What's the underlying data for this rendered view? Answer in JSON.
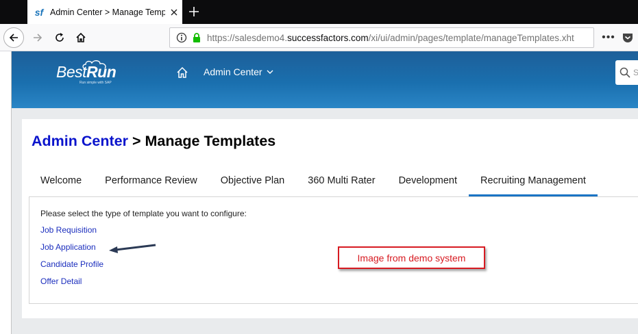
{
  "browser": {
    "tab_title": "Admin Center > Manage Temp",
    "favicon_text": "sf",
    "url_prefix": "https://salesdemo4.",
    "url_host": "successfactors.com",
    "url_path": "/xi/ui/admin/pages/template/manageTemplates.xht",
    "more_label": "•••"
  },
  "header": {
    "logo_main": "Best",
    "logo_bold": "Run",
    "logo_sub": "Run simple with SAP",
    "admin_menu_label": "Admin Center",
    "search_placeholder": "S"
  },
  "page": {
    "breadcrumb_link": "Admin Center",
    "breadcrumb_sep_title": " > Manage Templates",
    "tabs": [
      {
        "label": "Welcome"
      },
      {
        "label": "Performance Review"
      },
      {
        "label": "Objective Plan"
      },
      {
        "label": "360 Multi Rater"
      },
      {
        "label": "Development"
      },
      {
        "label": "Recruiting Management",
        "active": true
      }
    ],
    "prompt": "Please select the type of template you want to configure:",
    "links": [
      "Job Requisition",
      "Job Application",
      "Candidate Profile",
      "Offer Detail"
    ],
    "callout": "Image from demo system"
  },
  "colors": {
    "link": "#1a2dbd",
    "title_link": "#0a14cc",
    "active_tab": "#1a74c4",
    "callout": "#d71a21",
    "header_top": "#1d5f99",
    "header_bottom": "#2a86c6"
  }
}
